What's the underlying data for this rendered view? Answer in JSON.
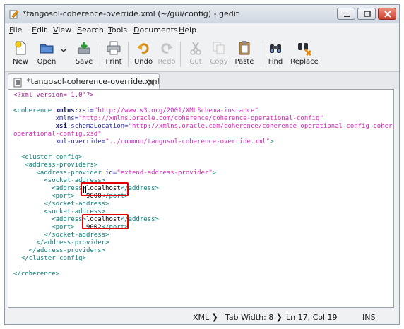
{
  "window": {
    "title": "*tangosol-coherence-override.xml (~/gui/config) - gedit"
  },
  "menubar": {
    "items": [
      {
        "accel": "F",
        "rest": "ile"
      },
      {
        "accel": "E",
        "rest": "dit"
      },
      {
        "accel": "V",
        "rest": "iew"
      },
      {
        "accel": "S",
        "rest": "earch"
      },
      {
        "accel": "T",
        "rest": "ools"
      },
      {
        "accel": "D",
        "rest": "ocuments"
      },
      {
        "accel": "H",
        "rest": "elp"
      }
    ]
  },
  "toolbar": {
    "new_label": "New",
    "open_label": "Open",
    "save_label": "Save",
    "print_label": "Print",
    "undo_label": "Undo",
    "redo_label": "Redo",
    "cut_label": "Cut",
    "copy_label": "Copy",
    "paste_label": "Paste",
    "find_label": "Find",
    "replace_label": "Replace"
  },
  "tab": {
    "label": "*tangosol-coherence-override.xml"
  },
  "editor": {
    "lines": [
      {
        "indent": "",
        "segs": [
          [
            "pi",
            "<?xml version='1.0'?>"
          ]
        ]
      },
      {
        "indent": "",
        "segs": []
      },
      {
        "indent": "",
        "segs": [
          [
            "tag",
            "<coherence "
          ],
          [
            "attrb",
            "xmlns"
          ],
          [
            "attr",
            ":xsi="
          ],
          [
            "str",
            "\"http://www.w3.org/2001/XMLSchema-instance\""
          ]
        ]
      },
      {
        "indent": "           ",
        "segs": [
          [
            "attr",
            "xmlns="
          ],
          [
            "str",
            "\"http://xmlns.oracle.com/coherence/coherence-operational-config\""
          ]
        ]
      },
      {
        "indent": "           ",
        "segs": [
          [
            "attrb",
            "xsi"
          ],
          [
            "attr",
            ":schemaLocation="
          ],
          [
            "str",
            "\"http://xmlns.oracle.com/coherence/coherence-operational-config coherence-"
          ]
        ]
      },
      {
        "indent": "",
        "segs": [
          [
            "str",
            "operational-config.xsd\""
          ]
        ]
      },
      {
        "indent": "           ",
        "segs": [
          [
            "attr",
            "xml-override="
          ],
          [
            "str",
            "\"../common/tangosol-coherence-override.xml\""
          ],
          [
            "tag",
            ">"
          ]
        ]
      },
      {
        "indent": "",
        "segs": []
      },
      {
        "indent": "  ",
        "segs": [
          [
            "tag",
            "<cluster-config>"
          ]
        ]
      },
      {
        "indent": "   ",
        "segs": [
          [
            "tag",
            "<address-providers>"
          ]
        ]
      },
      {
        "indent": "      ",
        "segs": [
          [
            "tag",
            "<address-provider "
          ],
          [
            "attr",
            "id="
          ],
          [
            "str",
            "\"extend-address-provider\""
          ],
          [
            "tag",
            ">"
          ]
        ]
      },
      {
        "indent": "        ",
        "segs": [
          [
            "tag",
            "<socket-address>"
          ]
        ]
      },
      {
        "indent": "          ",
        "segs": [
          [
            "tag",
            "<address>"
          ],
          [
            "text",
            "localhost"
          ],
          [
            "tag",
            "</address>"
          ]
        ]
      },
      {
        "indent": "          ",
        "segs": [
          [
            "tag",
            "<port>   "
          ],
          [
            "text",
            "9000"
          ],
          [
            "tag",
            "</port>"
          ]
        ]
      },
      {
        "indent": "        ",
        "segs": [
          [
            "tag",
            "</socket-address>"
          ]
        ]
      },
      {
        "indent": "        ",
        "segs": [
          [
            "tag",
            "<socket-address>"
          ]
        ]
      },
      {
        "indent": "          ",
        "segs": [
          [
            "tag",
            "<address>"
          ],
          [
            "text",
            "localhost"
          ],
          [
            "tag",
            "</address>"
          ]
        ]
      },
      {
        "indent": "          ",
        "segs": [
          [
            "tag",
            "<port>   "
          ],
          [
            "text",
            "9002"
          ],
          [
            "tag",
            "</port>"
          ]
        ]
      },
      {
        "indent": "        ",
        "segs": [
          [
            "tag",
            "</socket-address>"
          ]
        ]
      },
      {
        "indent": "      ",
        "segs": [
          [
            "tag",
            "</address-provider>"
          ]
        ]
      },
      {
        "indent": "    ",
        "segs": [
          [
            "tag",
            "</address-providers>"
          ]
        ]
      },
      {
        "indent": "  ",
        "segs": [
          [
            "tag",
            "</cluster-config>"
          ]
        ]
      },
      {
        "indent": "",
        "segs": []
      },
      {
        "indent": "",
        "segs": [
          [
            "tag",
            "</coherence>"
          ]
        ]
      }
    ]
  },
  "statusbar": {
    "language": "XML",
    "tab_width": "Tab Width:  8",
    "position": "Ln 17, Col 19",
    "mode": "INS"
  },
  "colors": {
    "processing_instruction": "#a0208f",
    "tag": "#0c7d7d",
    "attribute": "#2a2a9a",
    "string": "#d426b8",
    "highlight_box": "#e00000"
  }
}
